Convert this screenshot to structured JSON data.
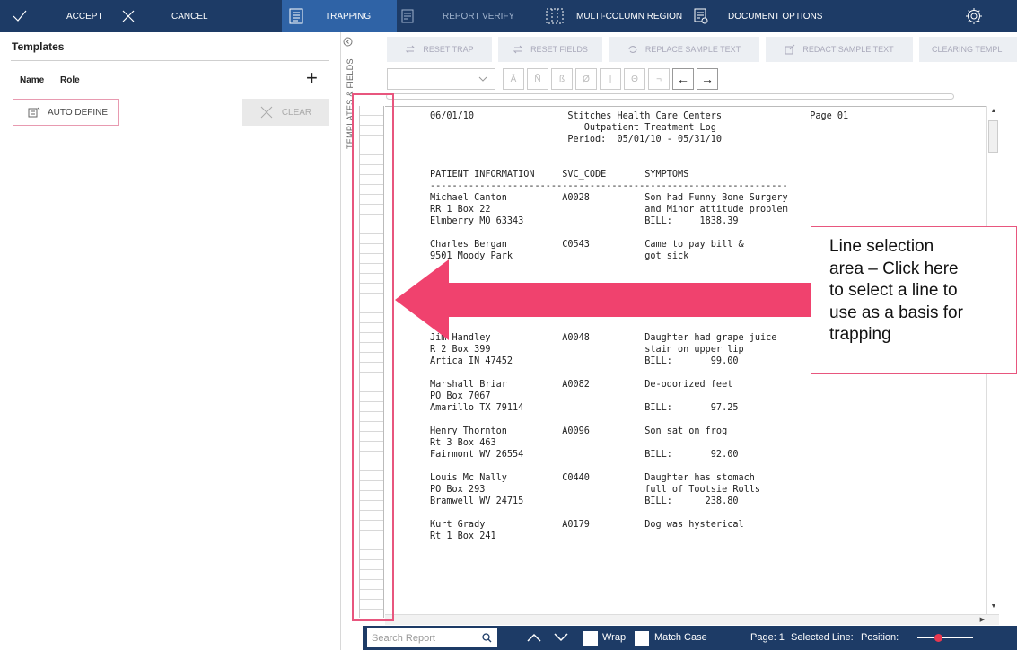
{
  "toolbar": {
    "accept": "ACCEPT",
    "cancel": "CANCEL",
    "trapping": "TRAPPING",
    "report_verify": "REPORT VERIFY",
    "multi_column": "MULTI-COLUMN REGION",
    "document_options": "DOCUMENT OPTIONS"
  },
  "sidebar": {
    "title": "Templates",
    "col_name": "Name",
    "col_role": "Role",
    "auto_define": "AUTO DEFINE",
    "clear": "CLEAR",
    "vertical_tab": "TEMPLATES & FIELDS"
  },
  "trap_toolbar": {
    "reset_trap": "RESET TRAP",
    "reset_fields": "RESET FIELDS",
    "replace_sample": "REPLACE SAMPLE TEXT",
    "redact_sample": "REDACT SAMPLE TEXT",
    "clearing_templ": "CLEARING TEMPL",
    "symbols": [
      "Ā",
      "Ñ",
      "ß",
      "Ø",
      "|",
      "Θ",
      "¬"
    ],
    "arrow_left": "←",
    "arrow_right": "→"
  },
  "report": {
    "text": "06/01/10                 Stitches Health Care Centers                Page 01\n                            Outpatient Treatment Log\n                         Period:  05/01/10 - 05/31/10\n\n\nPATIENT INFORMATION     SVC_CODE       SYMPTOMS\n-----------------------------------------------------------------\nMichael Canton          A0028          Son had Funny Bone Surgery\nRR 1 Box 22                            and Minor attitude problem\nElmberry MO 63343                      BILL:     1838.39\n\nCharles Bergan          C0543          Came to pay bill &\n9501 Moody Park                        got sick\n\n\nEric Dryson             A0032          Hang nail extraction\n119 Washington St\nCleveland OH 45215                     BILL:      192.00\n\nJim Handley             A0048          Daughter had grape juice\nR 2 Box 399                            stain on upper lip\nArtica IN 47452                        BILL:       99.00\n\nMarshall Briar          A0082          De-odorized feet\nPO Box 7067\nAmarillo TX 79114                      BILL:       97.25\n\nHenry Thornton          A0096          Son sat on frog\nRt 3 Box 463\nFairmont WV 26554                      BILL:       92.00\n\nLouis Mc Nally          C0440          Daughter has stomach\nPO Box 293                             full of Tootsie Rolls\nBramwell WV 24715                      BILL:      238.80\n\nKurt Grady              A0179          Dog was hysterical\nRt 1 Box 241"
  },
  "callout": {
    "text": "Line selection\narea – Click here\nto select a line to\nuse as a basis for\ntrapping"
  },
  "bottom": {
    "search_placeholder": "Search Report",
    "wrap": "Wrap",
    "match_case": "Match Case",
    "page": "Page: 1",
    "selected_line": "Selected Line:",
    "position": "Position:"
  },
  "colors": {
    "topbar": "#1d3b66",
    "active_tab": "#2f63a6",
    "highlight": "#e8567e"
  }
}
